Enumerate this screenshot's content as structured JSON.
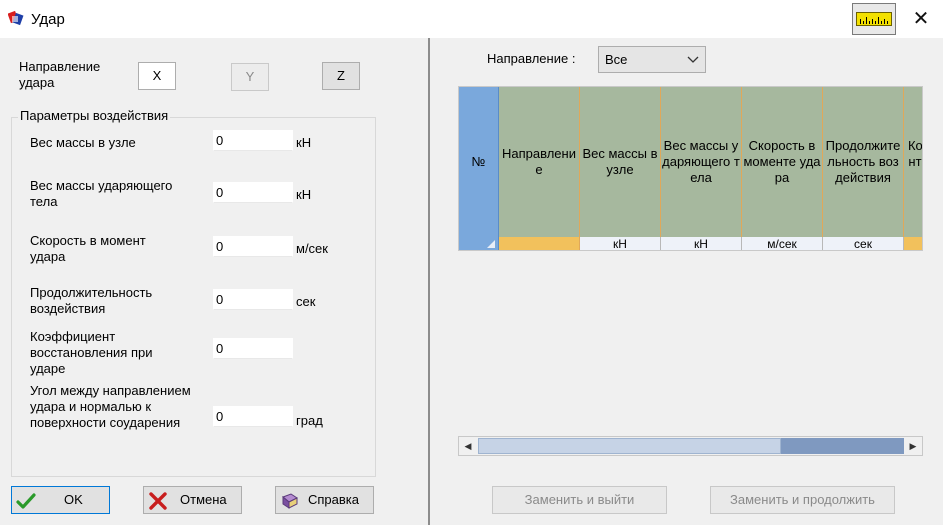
{
  "window": {
    "title": "Удар"
  },
  "left": {
    "direction_label": "Направление\nудара",
    "axis_buttons": [
      {
        "label": "X",
        "state": "active"
      },
      {
        "label": "Y",
        "state": "disabled"
      },
      {
        "label": "Z",
        "state": "normal"
      }
    ],
    "params_group_title": "Параметры воздействия",
    "params": [
      {
        "label": "Вес массы в узле",
        "value": "0",
        "unit": "кН"
      },
      {
        "label": "Вес массы ударяющего тела",
        "value": "0",
        "unit": "кН"
      },
      {
        "label": "Скорость в момент удара",
        "value": "0",
        "unit": "м/сек"
      },
      {
        "label": "Продолжительность воздействия",
        "value": "0",
        "unit": "сек"
      },
      {
        "label": "Коэффициент восстановления при ударе",
        "value": "0",
        "unit": ""
      },
      {
        "label": "Угол между направлением удара и нормалью к поверхности соударения",
        "value": "0",
        "unit": "град"
      }
    ],
    "buttons": {
      "ok": "OK",
      "cancel": "Отмена",
      "help": "Справка"
    }
  },
  "right": {
    "direction_filter_label": "Направление :",
    "direction_filter_value": "Все",
    "table": {
      "columns": [
        {
          "header": "№",
          "unit": ""
        },
        {
          "header": "Направление",
          "unit": ""
        },
        {
          "header": "Вес массы в узле",
          "unit": "кН"
        },
        {
          "header": "Вес массы ударяющего тела",
          "unit": "кН"
        },
        {
          "header": "Скорость в моменте удара",
          "unit": "м/сек"
        },
        {
          "header": "Продолжительность воздействия",
          "unit": "сек"
        },
        {
          "header": "Коэффициент восстановления",
          "unit": ""
        }
      ]
    },
    "buttons": {
      "replace_exit": "Заменить и выйти",
      "replace_continue": "Заменить и продолжить"
    }
  },
  "colors": {
    "header_bg": "#a6b89e",
    "number_col_bg": "#7aa8dc",
    "unit_orange": "#f2c15c",
    "ok_check": "#2a9a2a",
    "cancel_x": "#c81e1e"
  }
}
